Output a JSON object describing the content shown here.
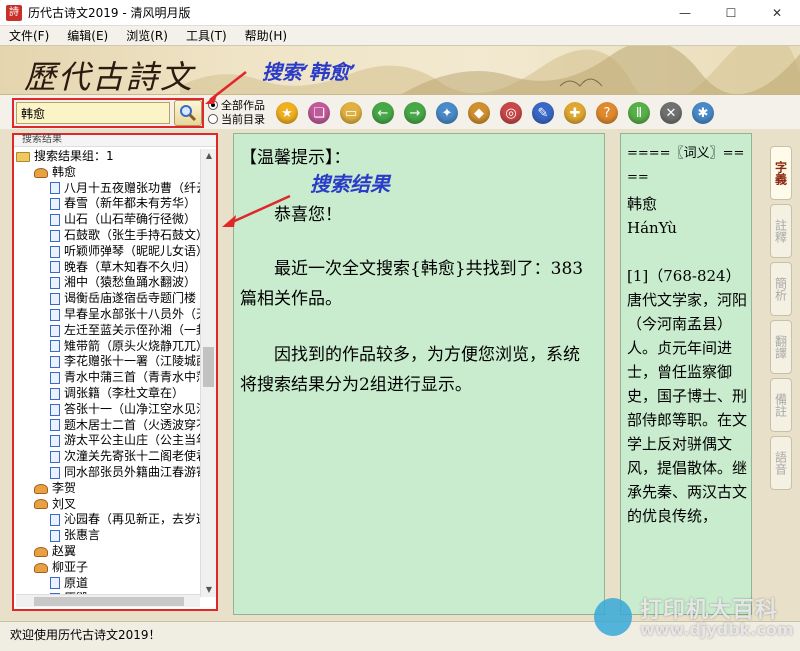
{
  "window": {
    "title": "历代古诗文2019 - 清风明月版",
    "app_icon_text": "詩"
  },
  "menu": [
    "文件(F)",
    "编辑(E)",
    "浏览(R)",
    "工具(T)",
    "帮助(H)"
  ],
  "banner": {
    "logo": "歷代古詩文"
  },
  "annotations": {
    "search_note": "搜索‘韩愈’",
    "result_note": "搜索结果"
  },
  "search": {
    "value": "韩愈"
  },
  "scope": {
    "options": [
      "全部作品",
      "当前目录"
    ],
    "selected": "全部作品"
  },
  "toolbar_icons": [
    {
      "name": "favorite-star-icon",
      "color": "#f0b020",
      "glyph": "★"
    },
    {
      "name": "books-icon",
      "color": "#c05a9a",
      "glyph": "❏"
    },
    {
      "name": "open-folder-icon",
      "color": "#e0b040",
      "glyph": "▭"
    },
    {
      "name": "back-arrow-icon",
      "color": "#48a848",
      "glyph": "←"
    },
    {
      "name": "forward-arrow-icon",
      "color": "#48a848",
      "glyph": "→"
    },
    {
      "name": "tools-icon",
      "color": "#4a8ac8",
      "glyph": "✦"
    },
    {
      "name": "lock-icon",
      "color": "#d09030",
      "glyph": "◆"
    },
    {
      "name": "disc-icon",
      "color": "#c84848",
      "glyph": "◎"
    },
    {
      "name": "edit-icon",
      "color": "#3a68c8",
      "glyph": "✎"
    },
    {
      "name": "new-folder-icon",
      "color": "#e0a830",
      "glyph": "✚"
    },
    {
      "name": "info-icon",
      "color": "#e08a30",
      "glyph": "?"
    },
    {
      "name": "pause-icon",
      "color": "#58b048",
      "glyph": "Ⅱ"
    },
    {
      "name": "stop-sound-icon",
      "color": "#707070",
      "glyph": "✕"
    },
    {
      "name": "settings-icon",
      "color": "#4a8ac8",
      "glyph": "✱"
    }
  ],
  "left": {
    "header": "搜索结果",
    "group": "搜索结果组：1",
    "tree": [
      {
        "type": "author",
        "text": "韩愈"
      },
      {
        "type": "doc",
        "text": "八月十五夜赠张功曹（纤云"
      },
      {
        "type": "doc",
        "text": "春雪（新年都未有芳华）"
      },
      {
        "type": "doc",
        "text": "山石（山石荦确行径微）"
      },
      {
        "type": "doc",
        "text": "石鼓歌（张生手持石鼓文）"
      },
      {
        "type": "doc",
        "text": "听颖师弹琴（昵昵儿女语）"
      },
      {
        "type": "doc",
        "text": "晚春（草木知春不久归）"
      },
      {
        "type": "doc",
        "text": "湘中（猿愁鱼踊水翻波）"
      },
      {
        "type": "doc",
        "text": "谒衡岳庙遂宿岳寺题门楼（"
      },
      {
        "type": "doc",
        "text": "早春呈水部张十八员外（天"
      },
      {
        "type": "doc",
        "text": "左迁至蓝关示侄孙湘（一封"
      },
      {
        "type": "doc",
        "text": "雉带箭（原头火烧静兀兀）"
      },
      {
        "type": "doc",
        "text": "李花赠张十一署（江陵城西"
      },
      {
        "type": "doc",
        "text": "青水中蒲三首（青青水中蒲"
      },
      {
        "type": "doc",
        "text": "调张籍（李杜文章在）"
      },
      {
        "type": "doc",
        "text": "答张十一（山净江空水见沙"
      },
      {
        "type": "doc",
        "text": "题木居士二首（火透波穿不"
      },
      {
        "type": "doc",
        "text": "游太平公主山庄（公主当年"
      },
      {
        "type": "doc",
        "text": "次潼关先寄张十二阁老使君"
      },
      {
        "type": "doc",
        "text": "同水部张员外籍曲江春游寄"
      },
      {
        "type": "author",
        "text": "李贺"
      },
      {
        "type": "author",
        "text": "刘叉"
      },
      {
        "type": "doc",
        "text": "沁园春（再见新正，去岁逃"
      },
      {
        "type": "doc",
        "text": "张惠言"
      },
      {
        "type": "author",
        "text": "赵翼"
      },
      {
        "type": "author",
        "text": "柳亚子"
      },
      {
        "type": "doc",
        "text": "原道"
      },
      {
        "type": "doc",
        "text": "原毁"
      },
      {
        "type": "doc",
        "text": "获麟解"
      }
    ]
  },
  "center": {
    "title": "【温馨提示】：",
    "paragraphs": [
      "恭喜您！",
      "最近一次全文搜索{韩愈}共找到了：383篇相关作品。",
      "因找到的作品较多，为方便您浏览，系统将搜索结果分为2组进行显示。"
    ]
  },
  "right": {
    "heading": "====〖词义〗====",
    "lines": [
      "韩愈",
      "HánYù",
      ""
    ],
    "definition": "[1]（768-824）唐代文学家，河阳（今河南孟县）人。贞元年间进士，曾任监察御史，国子博士、刑部侍郎等职。在文学上反对骈偶文风，提倡散体。继承先秦、两汉古文的优良传统，"
  },
  "side_tabs": [
    {
      "label": "字義",
      "active": true
    },
    {
      "label": "註釋",
      "active": false
    },
    {
      "label": "簡析",
      "active": false
    },
    {
      "label": "翻譯",
      "active": false
    },
    {
      "label": "備註",
      "active": false
    },
    {
      "label": "語音",
      "active": false
    }
  ],
  "status": {
    "text": "欢迎使用历代古诗文2019！"
  },
  "watermark": {
    "line1": "打印机大百科",
    "line2": "www.djydbk.com"
  },
  "colors": {
    "highlight": "#e0282a",
    "annotation": "#2a3bc8",
    "pane": "#c8eccd"
  }
}
